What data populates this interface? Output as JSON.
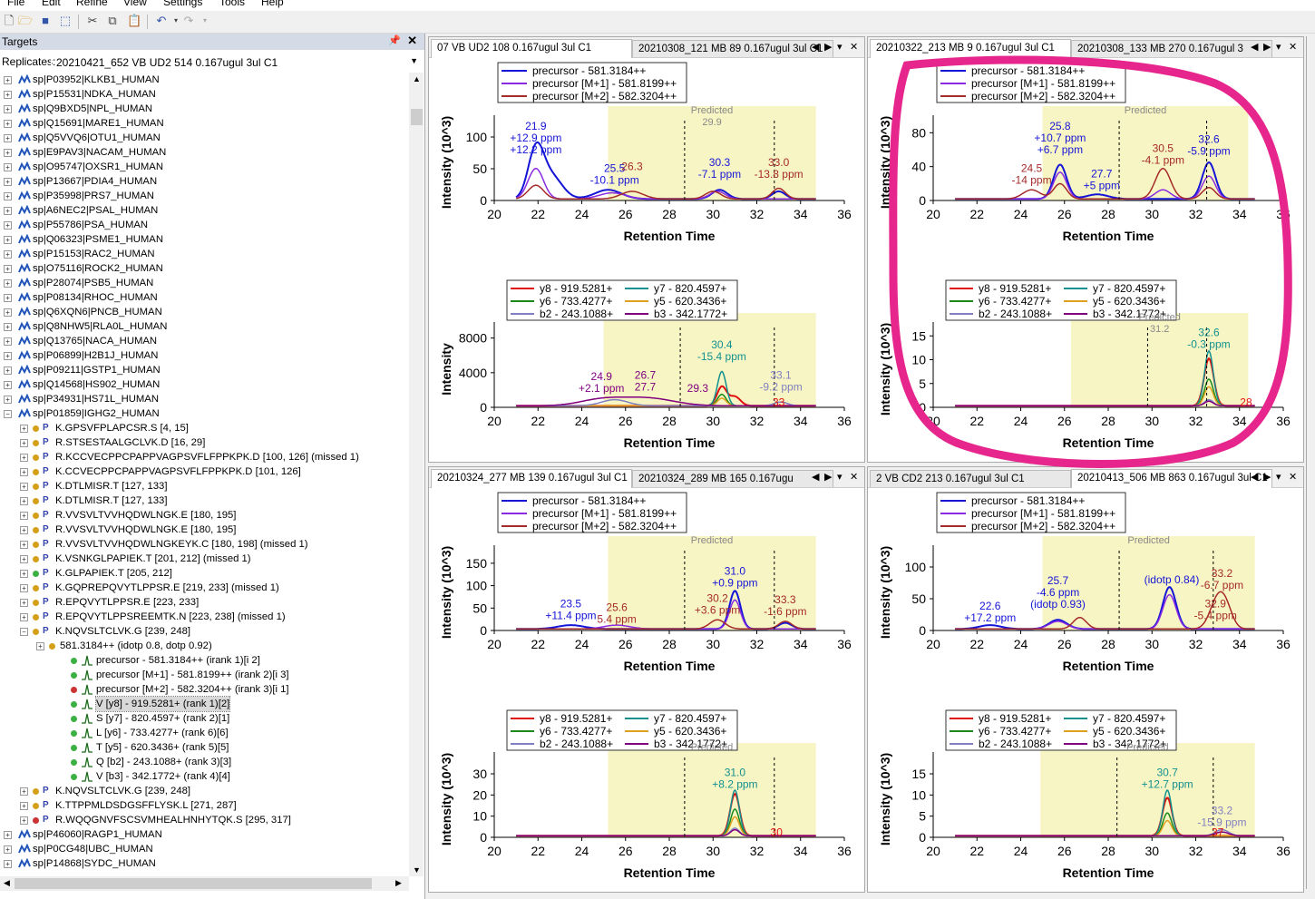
{
  "menu": [
    "File",
    "Edit",
    "Refine",
    "View",
    "Settings",
    "Tools",
    "Help"
  ],
  "targets_panel": {
    "title": "Targets",
    "replicates_label": "Replicates:",
    "replicate_value": "20210421_652 VB UD2 514 0.167ugul 3ul C1"
  },
  "tree": [
    {
      "kind": "protein",
      "text": "sp|P03952|KLKB1_HUMAN"
    },
    {
      "kind": "protein",
      "text": "sp|P15531|NDKA_HUMAN"
    },
    {
      "kind": "protein",
      "text": "sp|Q9BXD5|NPL_HUMAN"
    },
    {
      "kind": "protein",
      "text": "sp|Q15691|MARE1_HUMAN"
    },
    {
      "kind": "protein",
      "text": "sp|Q5VVQ6|OTU1_HUMAN"
    },
    {
      "kind": "protein",
      "text": "sp|E9PAV3|NACAM_HUMAN"
    },
    {
      "kind": "protein",
      "text": "sp|O95747|OXSR1_HUMAN"
    },
    {
      "kind": "protein",
      "text": "sp|P13667|PDIA4_HUMAN"
    },
    {
      "kind": "protein",
      "text": "sp|P35998|PRS7_HUMAN"
    },
    {
      "kind": "protein",
      "text": "sp|A6NEC2|PSAL_HUMAN"
    },
    {
      "kind": "protein",
      "text": "sp|P55786|PSA_HUMAN"
    },
    {
      "kind": "protein",
      "text": "sp|Q06323|PSME1_HUMAN"
    },
    {
      "kind": "protein",
      "text": "sp|P15153|RAC2_HUMAN"
    },
    {
      "kind": "protein",
      "text": "sp|O75116|ROCK2_HUMAN"
    },
    {
      "kind": "protein",
      "text": "sp|P28074|PSB5_HUMAN"
    },
    {
      "kind": "protein",
      "text": "sp|P08134|RHOC_HUMAN"
    },
    {
      "kind": "protein",
      "text": "sp|Q6XQN6|PNCB_HUMAN"
    },
    {
      "kind": "protein",
      "text": "sp|Q8NHW5|RLA0L_HUMAN"
    },
    {
      "kind": "protein",
      "text": "sp|Q13765|NACA_HUMAN"
    },
    {
      "kind": "protein",
      "text": "sp|P06899|H2B1J_HUMAN"
    },
    {
      "kind": "protein",
      "text": "sp|P09211|GSTP1_HUMAN"
    },
    {
      "kind": "protein",
      "text": "sp|Q14568|HS902_HUMAN"
    },
    {
      "kind": "protein",
      "text": "sp|P34931|HS71L_HUMAN"
    },
    {
      "kind": "protein-open",
      "text": "sp|P01859|IGHG2_HUMAN"
    },
    {
      "kind": "peptide",
      "dot": "#d4a017",
      "text": "K.GPSVFPLAPCSR.S [4, 15]"
    },
    {
      "kind": "peptide",
      "dot": "#d4a017",
      "text": "R.STSESTAALGCLVK.D [16, 29]"
    },
    {
      "kind": "peptide",
      "dot": "#d4a017",
      "text": "R.KCCVECPPCPAPPVAGPSVFLFPPKPK.D [100, 126] (missed 1)"
    },
    {
      "kind": "peptide",
      "dot": "#d4a017",
      "text": "K.CCVECPPCPAPPVAGPSVFLFPPKPK.D [101, 126]"
    },
    {
      "kind": "peptide",
      "dot": "#d4a017",
      "text": "K.DTLMISR.T [127, 133]"
    },
    {
      "kind": "peptide",
      "dot": "#d4a017",
      "text": "K.DTLMISR.T [127, 133]"
    },
    {
      "kind": "peptide",
      "dot": "#d4a017",
      "text": "R.VVSVLTVVHQDWLNGK.E [180, 195]"
    },
    {
      "kind": "peptide",
      "dot": "#d4a017",
      "text": "R.VVSVLTVVHQDWLNGK.E [180, 195]"
    },
    {
      "kind": "peptide",
      "dot": "#d4a017",
      "text": "R.VVSVLTVVHQDWLNGKEYK.C [180, 198] (missed 1)"
    },
    {
      "kind": "peptide",
      "dot": "#d4a017",
      "text": "K.VSNKGLPAPIEK.T [201, 212] (missed 1)"
    },
    {
      "kind": "peptide",
      "dot": "#3cb043",
      "text": "K.GLPAPIEK.T [205, 212]"
    },
    {
      "kind": "peptide",
      "dot": "#d4a017",
      "text": "K.GQPREPQVYTLPPSR.E [219, 233] (missed 1)"
    },
    {
      "kind": "peptide",
      "dot": "#d4a017",
      "text": "R.EPQVYTLPPSR.E [223, 233]"
    },
    {
      "kind": "peptide",
      "dot": "#d4a017",
      "text": "R.EPQVYTLPPSREEMTK.N [223, 238] (missed 1)"
    },
    {
      "kind": "peptide-open",
      "dot": "#d4a017",
      "text": "K.NQVSLTCLVK.G [239, 248]"
    },
    {
      "kind": "precursor",
      "dot": "#d4a017",
      "text": "581.3184++ (idotp 0.8, dotp 0.92)"
    },
    {
      "kind": "transition",
      "dot": "#3cb043",
      "text": "precursor - 581.3184++ (irank 1)[i 2]"
    },
    {
      "kind": "transition",
      "dot": "#3cb043",
      "text": "precursor [M+1] - 581.8199++ (irank 2)[i 3]"
    },
    {
      "kind": "transition",
      "dot": "#cc3333",
      "text": "precursor [M+2] - 582.3204++ (irank 3)[i 1]"
    },
    {
      "kind": "transition-sel",
      "dot": "#3cb043",
      "text": "V [y8] - 919.5281+ (rank 1)[2]"
    },
    {
      "kind": "transition",
      "dot": "#3cb043",
      "text": "S [y7] - 820.4597+ (rank 2)[1]"
    },
    {
      "kind": "transition",
      "dot": "#3cb043",
      "text": "L [y6] - 733.4277+ (rank 6)[6]"
    },
    {
      "kind": "transition",
      "dot": "#3cb043",
      "text": "T [y5] - 620.3436+ (rank 5)[5]"
    },
    {
      "kind": "transition",
      "dot": "#3cb043",
      "text": "Q [b2] - 243.1088+ (rank 3)[3]"
    },
    {
      "kind": "transition",
      "dot": "#3cb043",
      "text": "V [b3] - 342.1772+ (rank 4)[4]"
    },
    {
      "kind": "peptide",
      "dot": "#d4a017",
      "text": "K.NQVSLTCLVK.G [239, 248]"
    },
    {
      "kind": "peptide",
      "dot": "#d4a017",
      "text": "K.TTPPMLDSDGSFFLYSK.L [271, 287]"
    },
    {
      "kind": "peptide",
      "dot": "#cc3333",
      "text": "R.WQQGNVFSCSVMHEALHNHYTQK.S [295, 317]"
    },
    {
      "kind": "protein",
      "text": "sp|P46060|RAGP1_HUMAN"
    },
    {
      "kind": "protein",
      "text": "sp|P0CG48|UBC_HUMAN"
    },
    {
      "kind": "protein",
      "text": "sp|P14868|SYDC_HUMAN"
    }
  ],
  "legend_precursor": [
    "precursor - 581.3184++",
    "precursor [M+1] - 581.8199++",
    "precursor [M+2] - 582.3204++"
  ],
  "legend_fragment": [
    "y8 - 919.5281+",
    "y7 - 820.4597+",
    "y6 - 733.4277+",
    "y5 - 620.3436+",
    "b2 - 243.1088+",
    "b3 - 342.1772+"
  ],
  "colors": {
    "precursor": "#1515d8",
    "m1": "#8a2be2",
    "m2": "#a52a2a",
    "y8": "#e01010",
    "y7": "#129090",
    "y6": "#1a8a1a",
    "y5": "#e0a020",
    "b2": "#8080c0",
    "b3": "#800080",
    "peak_band": "#f8f5c4",
    "highlight": "#e6268c"
  },
  "xlabel": "Retention Time",
  "panes": [
    {
      "tabs": [
        "07 VB UD2 108 0.167ugul 3ul C1",
        "20210308_121 MB 89 0.167ugul 3ul C1"
      ],
      "active_tab": 0,
      "charts": [
        {
          "legend": "precursor",
          "ylabel": "Intensity (10^3)",
          "yticks": [
            0,
            50,
            100
          ],
          "ymax": 120,
          "xticks": [
            20,
            22,
            24,
            26,
            28,
            30,
            32,
            34,
            36
          ],
          "band": [
            25.2,
            34.7
          ],
          "predicted": {
            "label": "Predicted",
            "rt": "29.9"
          },
          "labels": [
            [
              "21.9",
              "+12.9 ppm",
              "+12.2 ppm"
            ],
            [
              "25.5",
              "-10.1 ppm"
            ],
            [
              "26.3"
            ],
            [
              "30.3",
              "-7.1 ppm"
            ],
            [
              "33.0",
              "-13.8 ppm"
            ]
          ]
        },
        {
          "legend": "fragment",
          "ylabel": "Intensity",
          "yticks": [
            0,
            4000,
            8000
          ],
          "ymax": 8800,
          "xticks": [
            20,
            22,
            24,
            26,
            28,
            30,
            32,
            34,
            36
          ],
          "band": [
            25.0,
            34.7
          ],
          "labels": [
            [
              "30.4",
              "-15.4 ppm"
            ],
            [
              "24.9",
              "+2.1 ppm"
            ],
            [
              "26.7",
              "27.7"
            ],
            [
              "29.3"
            ],
            [
              "33.1",
              "-9.2 ppm"
            ],
            [
              "33"
            ]
          ]
        }
      ]
    },
    {
      "tabs": [
        "20210322_213 MB 9 0.167ugul 3ul C1",
        "20210308_133 MB 270 0.167ugul 3"
      ],
      "active_tab": 0,
      "charts": [
        {
          "legend": "precursor",
          "ylabel": "Intensity (10^3)",
          "yticks": [
            0,
            40,
            80
          ],
          "ymax": 90,
          "xticks": [
            20,
            22,
            24,
            26,
            28,
            30,
            32,
            34,
            36
          ],
          "band": [
            25.0,
            34.4
          ],
          "predicted": {
            "label": "Predicted",
            "rt": ""
          },
          "labels": [
            [
              "25.8",
              "+10.7 ppm",
              "+6.7 ppm"
            ],
            [
              "24.5",
              "-14 ppm"
            ],
            [
              "27.7",
              "+5 ppm"
            ],
            [
              "30.5",
              "-4.1 ppm"
            ],
            [
              "32.6",
              "-5.9 ppm"
            ]
          ]
        },
        {
          "legend": "fragment",
          "ylabel": "Intensity (10^3)",
          "yticks": [
            0,
            5,
            10,
            15
          ],
          "ymax": 16,
          "xticks": [
            20,
            22,
            24,
            26,
            28,
            30,
            32,
            34,
            36
          ],
          "band": [
            26.3,
            34.4
          ],
          "predicted": {
            "label": "Predicted",
            "rt": "31.2"
          },
          "labels": [
            [
              "32.6",
              "-0.3 ppm"
            ],
            [
              "28"
            ]
          ]
        }
      ]
    },
    {
      "tabs": [
        "20210324_277 MB 139 0.167ugul 3ul C1",
        "20210324_289 MB 165 0.167ugu"
      ],
      "active_tab": 0,
      "charts": [
        {
          "legend": "precursor",
          "ylabel": "Intensity (10^3)",
          "yticks": [
            0,
            50,
            100,
            150
          ],
          "ymax": 170,
          "xticks": [
            20,
            22,
            24,
            26,
            28,
            30,
            32,
            34,
            36
          ],
          "band": [
            25.2,
            34.7
          ],
          "predicted": {
            "label": "Predicted",
            "rt": ""
          },
          "labels": [
            [
              "31.0",
              "+0.9 ppm"
            ],
            [
              "23.5",
              "+11.4 ppm"
            ],
            [
              "25.6",
              "5.4 ppm"
            ],
            [
              "30.2",
              "+3.6 ppm"
            ],
            [
              "33.3",
              "-1.6 ppm"
            ]
          ]
        },
        {
          "legend": "fragment",
          "ylabel": "Intensity (10^3)",
          "yticks": [
            0,
            10,
            20,
            30
          ],
          "ymax": 36,
          "xticks": [
            20,
            22,
            24,
            26,
            28,
            30,
            32,
            34,
            36
          ],
          "band": [
            25.2,
            34.7
          ],
          "predicted": {
            "label": "Predicted",
            "rt": ""
          },
          "labels": [
            [
              "31.0",
              "+8.2 ppm"
            ],
            [
              "30"
            ]
          ]
        }
      ]
    },
    {
      "tabs": [
        "2 VB CD2 213 0.167ugul 3ul C1",
        "20210413_506 MB 863 0.167ugul 3ul C1"
      ],
      "active_tab": 1,
      "charts": [
        {
          "legend": "precursor",
          "ylabel": "Intensity (10^3)",
          "yticks": [
            0,
            50,
            100
          ],
          "ymax": 120,
          "xticks": [
            20,
            22,
            24,
            26,
            28,
            30,
            32,
            34,
            36
          ],
          "band": [
            25.0,
            34.7
          ],
          "predicted": {
            "label": "Predicted",
            "rt": ""
          },
          "labels": [
            [
              "(idotp 0.84)"
            ],
            [
              "25.7",
              "-4.6 ppm",
              "(idotp 0.93)"
            ],
            [
              "22.6",
              "+17.2 ppm"
            ],
            [
              "33.2",
              "-6.7 ppm"
            ],
            [
              "32.9",
              "-5.4 ppm"
            ]
          ]
        },
        {
          "legend": "fragment",
          "ylabel": "Intensity (10^3)",
          "yticks": [
            0,
            5,
            10,
            15
          ],
          "ymax": 18,
          "xticks": [
            20,
            22,
            24,
            26,
            28,
            30,
            32,
            34,
            36
          ],
          "band": [
            24.9,
            34.7
          ],
          "predicted": {
            "label": "Predicted",
            "rt": ""
          },
          "labels": [
            [
              "30.7",
              "+12.7 ppm"
            ],
            [
              "33.2",
              "-15.9 ppm"
            ],
            [
              "37"
            ]
          ]
        }
      ]
    }
  ]
}
